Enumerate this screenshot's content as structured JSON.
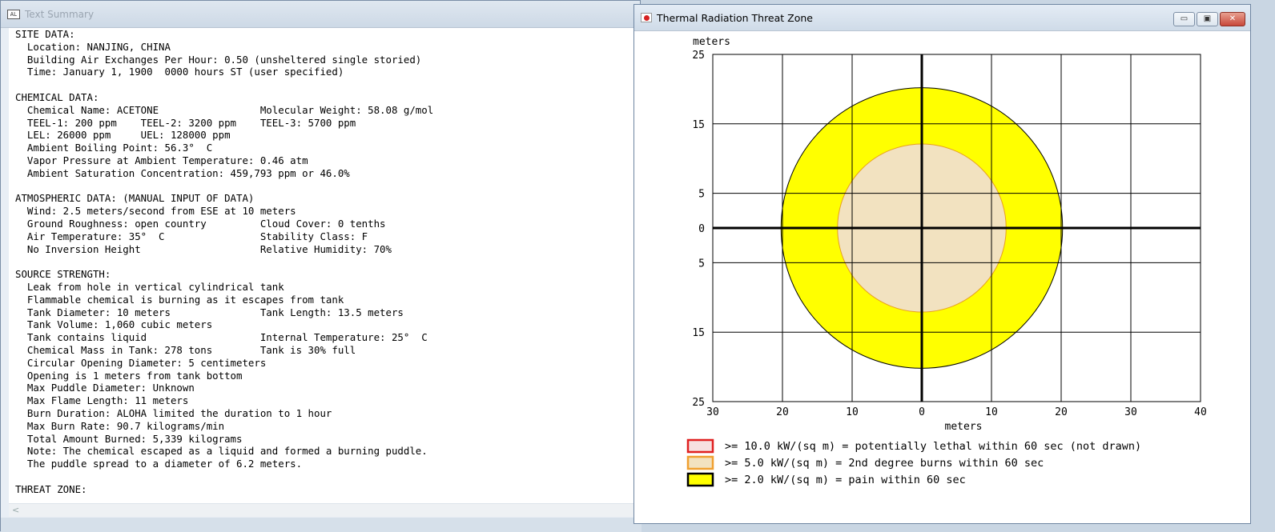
{
  "text_window": {
    "title": "Text Summary",
    "icon": "aloha-app-icon",
    "scroll_left_glyph": "<",
    "lines": [
      "SITE DATA:",
      "  Location: NANJING, CHINA",
      "  Building Air Exchanges Per Hour: 0.50 (unsheltered single storied)",
      "  Time: January 1, 1900  0000 hours ST (user specified)",
      "",
      "CHEMICAL DATA:",
      "  Chemical Name: ACETONE                 Molecular Weight: 58.08 g/mol",
      "  TEEL-1: 200 ppm    TEEL-2: 3200 ppm    TEEL-3: 5700 ppm",
      "  LEL: 26000 ppm     UEL: 128000 ppm",
      "  Ambient Boiling Point: 56.3°  C",
      "  Vapor Pressure at Ambient Temperature: 0.46 atm",
      "  Ambient Saturation Concentration: 459,793 ppm or 46.0%",
      "",
      "ATMOSPHERIC DATA: (MANUAL INPUT OF DATA)",
      "  Wind: 2.5 meters/second from ESE at 10 meters",
      "  Ground Roughness: open country         Cloud Cover: 0 tenths",
      "  Air Temperature: 35°  C                Stability Class: F",
      "  No Inversion Height                    Relative Humidity: 70%",
      "",
      "SOURCE STRENGTH:",
      "  Leak from hole in vertical cylindrical tank",
      "  Flammable chemical is burning as it escapes from tank",
      "  Tank Diameter: 10 meters               Tank Length: 13.5 meters",
      "  Tank Volume: 1,060 cubic meters",
      "  Tank contains liquid                   Internal Temperature: 25°  C",
      "  Chemical Mass in Tank: 278 tons        Tank is 30% full",
      "  Circular Opening Diameter: 5 centimeters",
      "  Opening is 1 meters from tank bottom",
      "  Max Puddle Diameter: Unknown",
      "  Max Flame Length: 11 meters",
      "  Burn Duration: ALOHA limited the duration to 1 hour",
      "  Max Burn Rate: 90.7 kilograms/min",
      "  Total Amount Burned: 5,339 kilograms",
      "  Note: The chemical escaped as a liquid and formed a burning puddle.",
      "  The puddle spread to a diameter of 6.2 meters.",
      "",
      "THREAT ZONE:"
    ]
  },
  "chart_window": {
    "title": "Thermal Radiation Threat Zone",
    "icon": "threat-zone-icon",
    "buttons": {
      "minimize": "▭",
      "maximize": "▣",
      "close": "✕"
    }
  },
  "chart_data": {
    "type": "area",
    "title": "",
    "xlabel": "meters",
    "ylabel": "meters",
    "xlim": [
      -30,
      40
    ],
    "ylim": [
      -25,
      25
    ],
    "xticks": [
      -30,
      -20,
      -10,
      0,
      10,
      20,
      30,
      40
    ],
    "xtick_labels": [
      "30",
      "20",
      "10",
      "0",
      "10",
      "20",
      "30",
      "40"
    ],
    "yticks": [
      25,
      15,
      5,
      0,
      -5,
      -15,
      -25
    ],
    "ytick_labels": [
      "25",
      "15",
      "5",
      "0",
      "5",
      "15",
      "25"
    ],
    "grid": true,
    "zones": [
      {
        "name": "yellow-zone",
        "radius": 20.2,
        "fill": "#ffff00",
        "stroke": "#000000"
      },
      {
        "name": "orange-zone",
        "radius": 12.1,
        "fill": "#f2e2c0",
        "stroke": "#e8a020"
      }
    ],
    "legend": [
      {
        "label": ">= 10.0 kW/(sq m) = potentially lethal within 60 sec (not drawn)",
        "fill": "#f7e0e0",
        "stroke": "#e02020"
      },
      {
        "label": ">= 5.0 kW/(sq m) = 2nd degree burns within 60 sec",
        "fill": "#f2e2c0",
        "stroke": "#f0a030"
      },
      {
        "label": ">= 2.0 kW/(sq m) = pain within 60 sec",
        "fill": "#ffff00",
        "stroke": "#000000"
      }
    ],
    "legend_position": "bottom"
  }
}
